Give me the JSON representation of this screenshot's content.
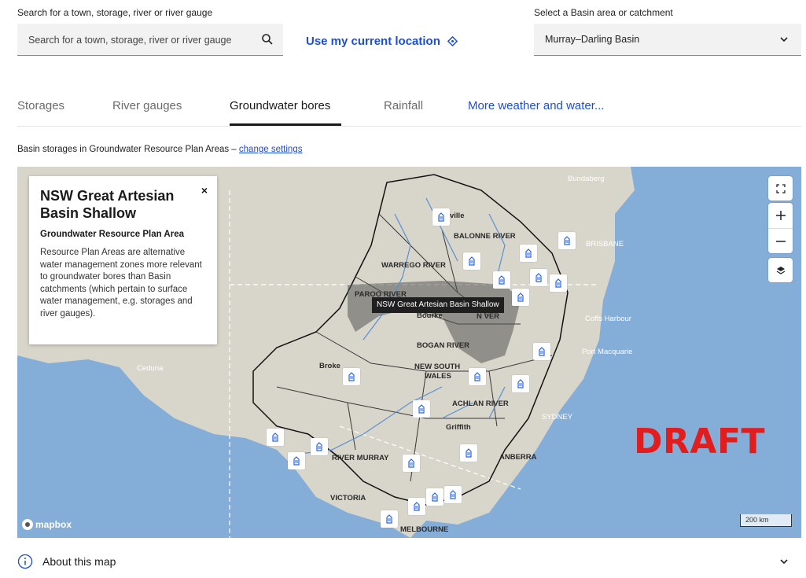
{
  "search": {
    "label": "Search for a town, storage, river or river gauge",
    "placeholder": "Search for a town, storage, river or river gauge"
  },
  "location": {
    "label": "Use my current location"
  },
  "basin": {
    "label": "Select a Basin area or catchment",
    "selected": "Murray–Darling Basin"
  },
  "tabs": [
    {
      "label": "Storages",
      "active": false
    },
    {
      "label": "River gauges",
      "active": false
    },
    {
      "label": "Groundwater bores",
      "active": true
    },
    {
      "label": "Rainfall",
      "active": false
    },
    {
      "label": "More weather and water...",
      "active": false
    }
  ],
  "settings": {
    "text": "Basin storages in Groundwater Resource Plan Areas – ",
    "link": "change settings"
  },
  "info_card": {
    "title": "NSW Great Artesian Basin Shallow",
    "subtitle": "Groundwater Resource Plan Area",
    "description": "Resource Plan Areas are alternative water management zones more relevant to groundwater bores than Basin catchments (which pertain to surface water management, e.g. storages and river gauges).",
    "close": "×"
  },
  "tooltip": "NSW Great Artesian Basin Shallow",
  "places": {
    "bundaberg": "Bundaberg",
    "brisbane": "BRISBANE",
    "coffs": "Coffs Harbour",
    "port_macquarie": "Port Macquarie",
    "sydney": "SYDNEY",
    "canberra": "ANBERRA",
    "melbourne": "MELBOURNE",
    "victoria": "VICTORIA",
    "ceduna": "Ceduna",
    "nsw": "NEW SOUTH",
    "wales": "WALES",
    "balonne": "BALONNE RIVER",
    "warrego": "WARREGO RIVER",
    "paroo": "PAROO RIVER",
    "bogan": "BOGAN RIVER",
    "lachlan": "ACHLAN RIVER",
    "murray": "RIVER MURRAY",
    "griffith": "Griffith",
    "bourke": "Bourke",
    "broken": "Broke",
    "ville": "ville",
    "namoi": "N     VER"
  },
  "draft": "DRAFT",
  "scale": "200 km",
  "mapbox": "mapbox",
  "about": {
    "label": "About this map"
  },
  "colors": {
    "accent": "#1d4ed8",
    "water": "#84aed8",
    "land": "#d8d5cb",
    "draft": "#e11d1d"
  }
}
